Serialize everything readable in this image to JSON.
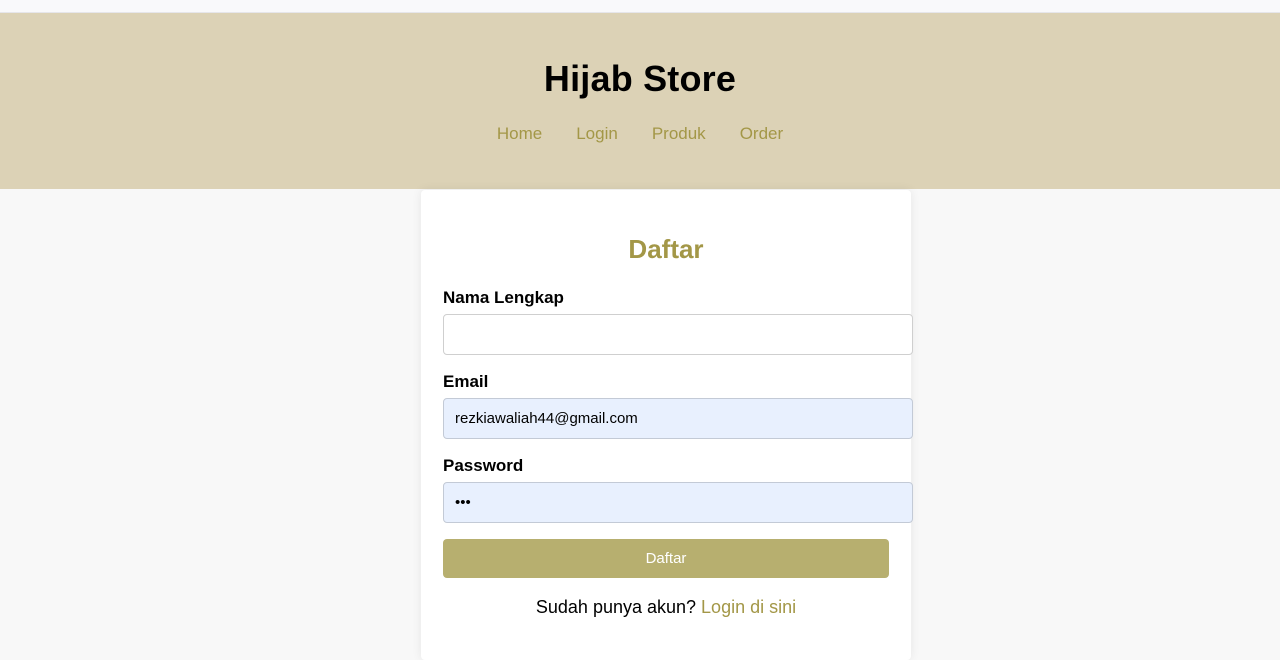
{
  "header": {
    "title": "Hijab Store",
    "nav": [
      "Home",
      "Login",
      "Produk",
      "Order"
    ]
  },
  "form": {
    "title": "Daftar",
    "fields": {
      "nama_label": "Nama Lengkap",
      "nama_value": "",
      "email_label": "Email",
      "email_value": "rezkiawaliah44@gmail.com",
      "password_label": "Password",
      "password_value": "abc"
    },
    "submit_label": "Daftar",
    "login_prompt": "Sudah punya akun?",
    "login_link": "Login di sini"
  },
  "colors": {
    "header_bg": "#dcd2b6",
    "accent": "#a39747",
    "button_bg": "#b7af6f",
    "autofill_bg": "#e8f0fe"
  }
}
